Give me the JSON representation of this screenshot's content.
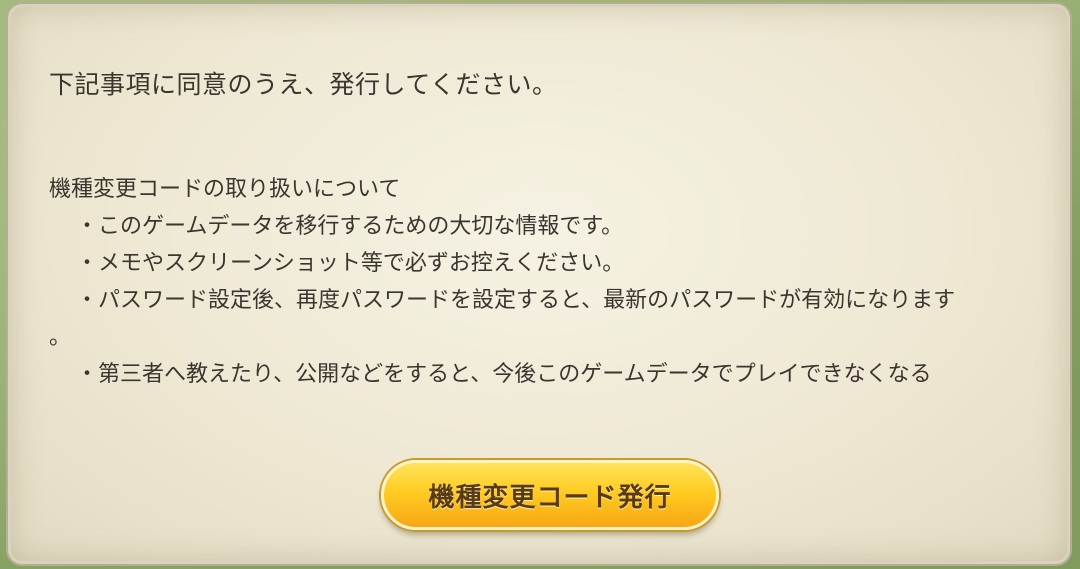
{
  "dialog": {
    "heading": "下記事項に同意のうえ、発行してください。",
    "notes_title": "機種変更コードの取り扱いについて",
    "bullet": "・",
    "notes": [
      "このゲームデータを移行するための大切な情報です。",
      "メモやスクリーンショット等で必ずお控えください。",
      "パスワード設定後、再度パスワードを設定すると、最新のパスワードが有効になります",
      "第三者へ教えたり、公開などをすると、今後このゲームデータでプレイできなくなる"
    ],
    "note_3_wrap": "。",
    "button_label": "機種変更コード発行"
  }
}
